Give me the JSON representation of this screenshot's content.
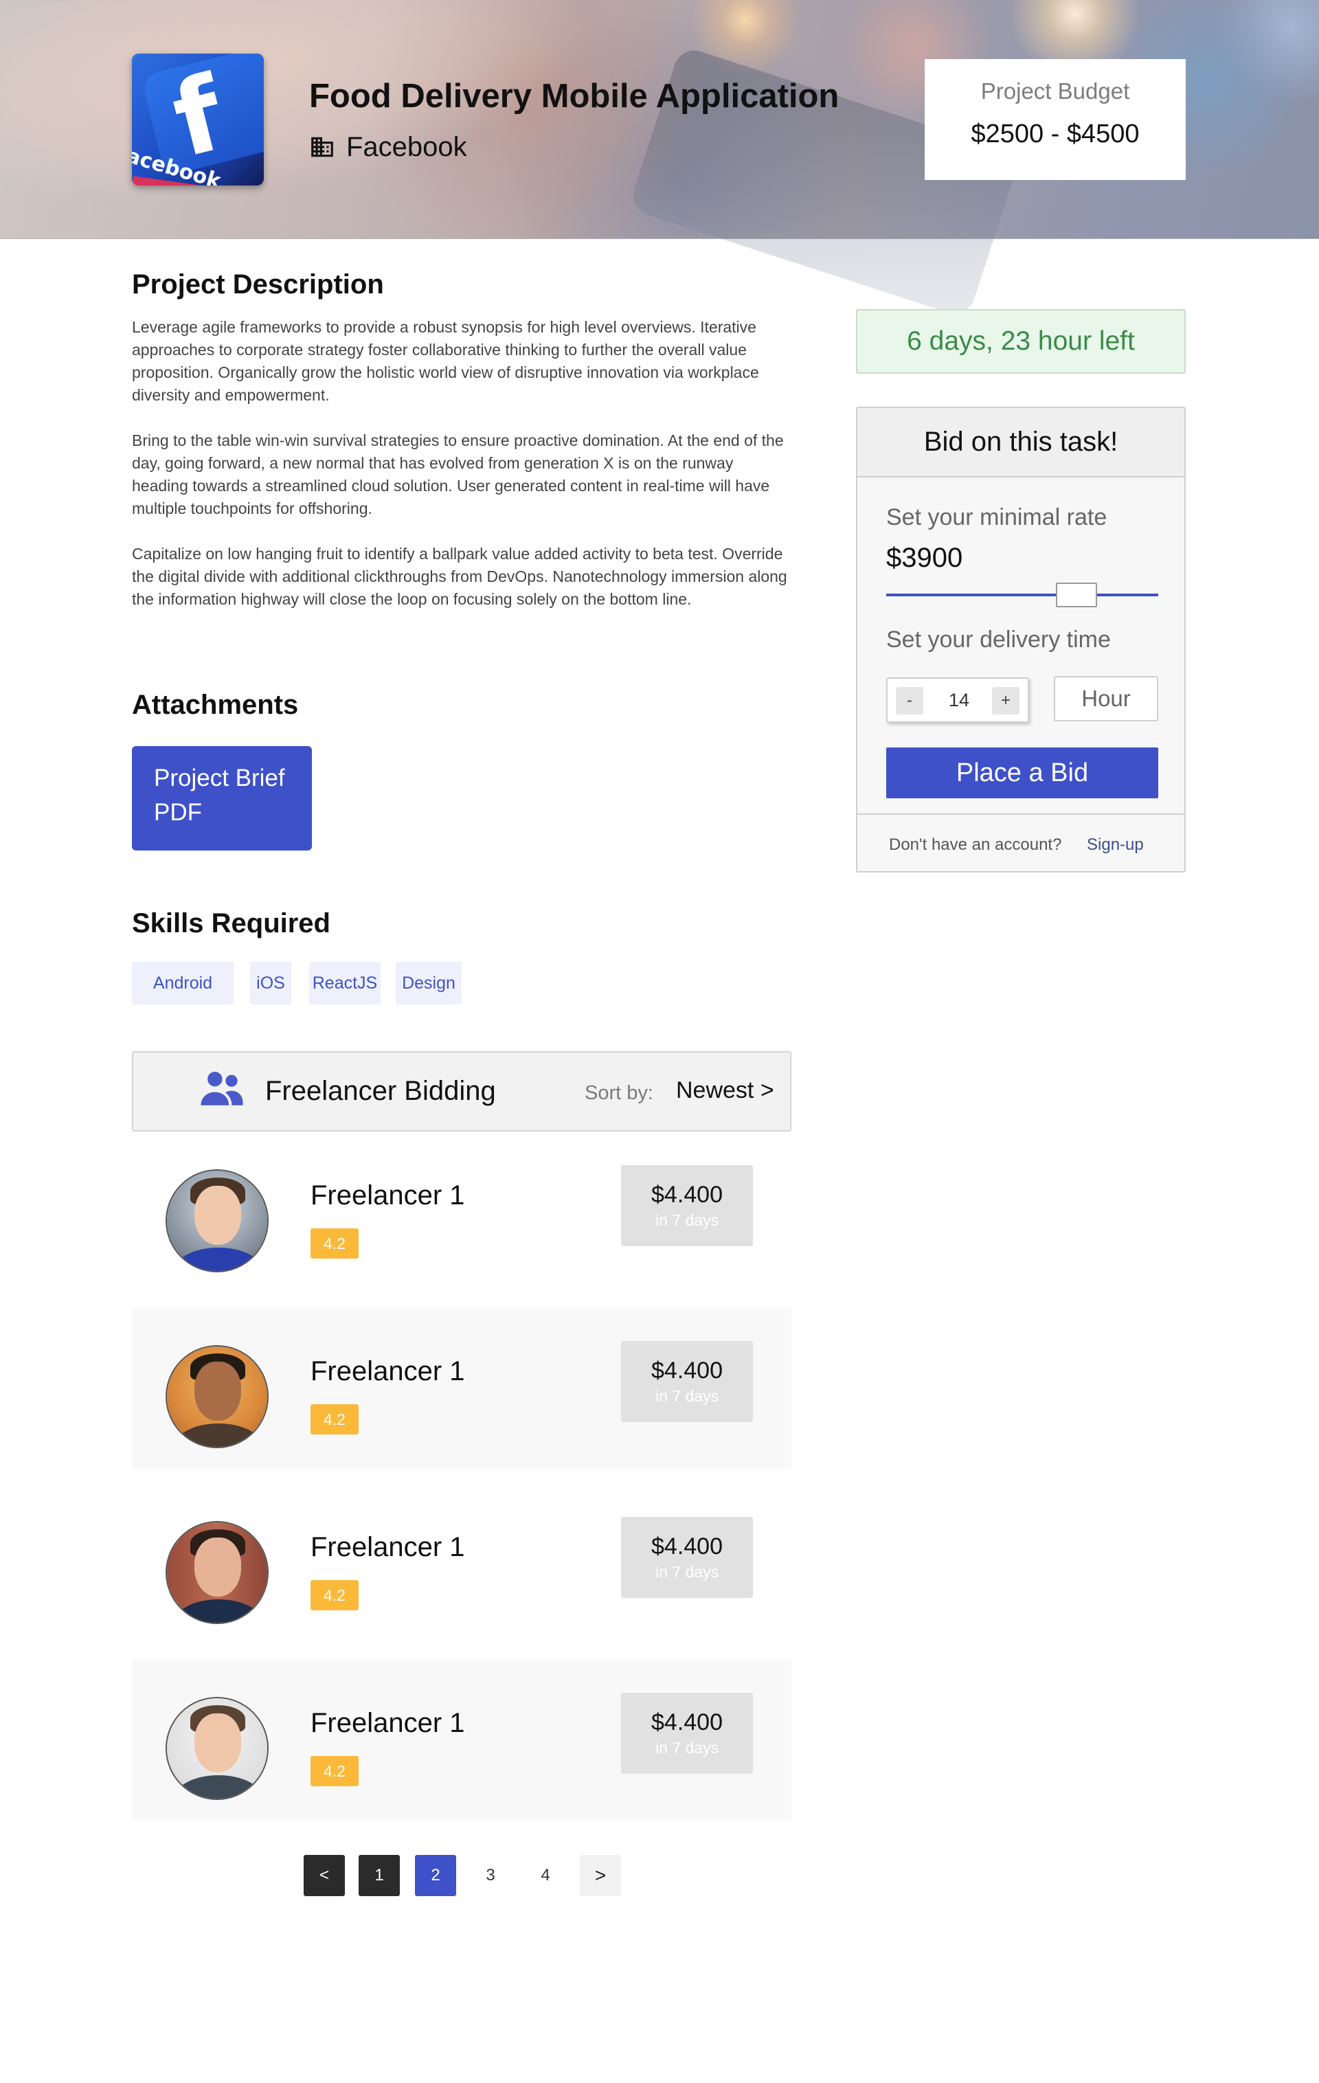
{
  "header": {
    "project_title": "Food Delivery Mobile Application",
    "company_name": "Facebook",
    "logo_text": "f",
    "logo_word": "acebook",
    "budget_label": "Project Budget",
    "budget_value": "$2500 - $4500"
  },
  "description": {
    "heading": "Project Description",
    "paragraphs": [
      "Leverage agile frameworks to provide a robust synopsis for high level overviews. Iterative approaches to corporate strategy foster collaborative thinking to further the overall value proposition. Organically grow the holistic world view of disruptive innovation via workplace diversity and empowerment.",
      "Bring to the table win-win survival strategies to ensure proactive domination. At the end of the day, going forward, a new normal that has evolved from generation X is on the runway heading towards a streamlined cloud solution. User generated content in real-time will have multiple touchpoints for offshoring.",
      "Capitalize on low hanging fruit to identify a ballpark value added activity to beta test. Override the digital divide with additional clickthroughs from DevOps. Nanotechnology immersion along the information highway will close the loop on focusing solely on the bottom line."
    ]
  },
  "attachments": {
    "heading": "Attachments",
    "file_label": "Project Brief PDF"
  },
  "skills": {
    "heading": "Skills Required",
    "items": [
      "Android",
      "iOS",
      "ReactJS",
      "Design"
    ]
  },
  "bidding": {
    "title": "Freelancer Bidding",
    "sort_label": "Sort by:",
    "sort_value": "Newest >",
    "freelancers": [
      {
        "name": "Freelancer 1",
        "rating": "4.2",
        "price": "$4.400",
        "duration": "in 7 days"
      },
      {
        "name": "Freelancer 1",
        "rating": "4.2",
        "price": "$4.400",
        "duration": "in 7 days"
      },
      {
        "name": "Freelancer 1",
        "rating": "4.2",
        "price": "$4.400",
        "duration": "in 7 days"
      },
      {
        "name": "Freelancer 1",
        "rating": "4.2",
        "price": "$4.400",
        "duration": "in 7 days"
      }
    ]
  },
  "pagination": {
    "prev": "<",
    "pages": [
      "1",
      "2",
      "3",
      "4"
    ],
    "current_page": "2",
    "next": ">"
  },
  "sidebar": {
    "time_left": "6 days, 23 hour left",
    "bid_card": {
      "title": "Bid on this task!",
      "rate_label": "Set your minimal rate",
      "rate_value": "$3900",
      "rate_slider_fraction": 0.7,
      "time_label": "Set your delivery time",
      "stepper_minus": "-",
      "stepper_value": "14",
      "stepper_plus": "+",
      "time_unit": "Hour",
      "place_bid_label": "Place a Bid",
      "no_account_text": "Don't have an account?",
      "signup_label": "Sign-up"
    }
  },
  "icons": {
    "company": "building-icon",
    "bidding": "people-icon"
  },
  "colors": {
    "accent": "#3f51c8",
    "rating": "#fbb93a",
    "time_left_bg": "#e8f7ea",
    "time_left_text": "#3b8a49",
    "pager_dark": "#2b2b2b"
  }
}
